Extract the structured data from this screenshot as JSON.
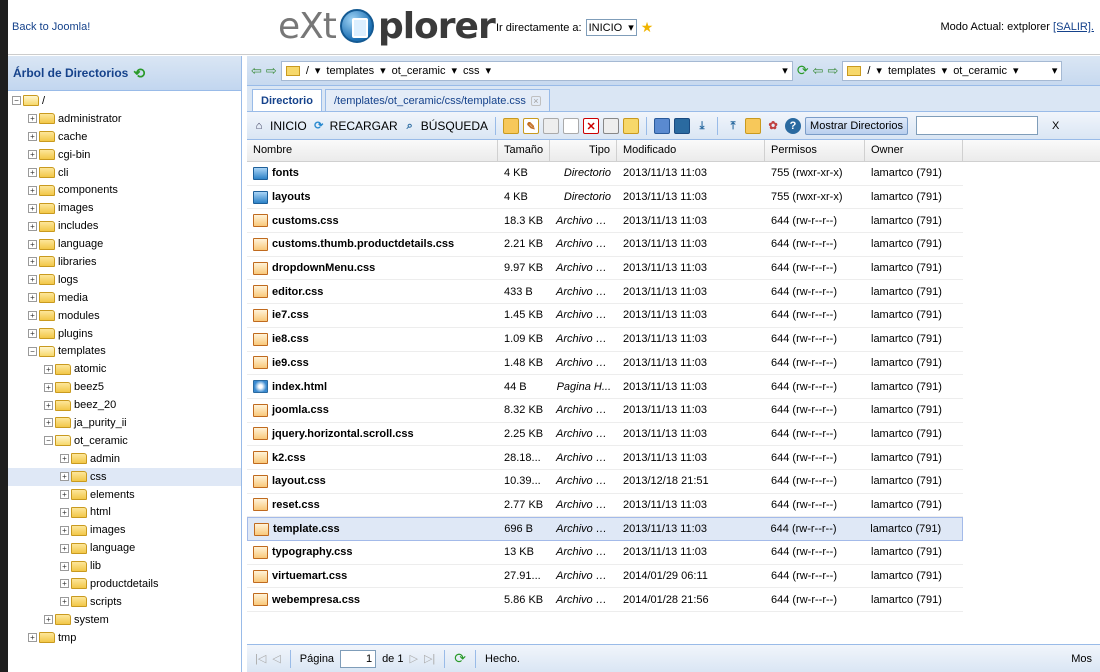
{
  "header": {
    "back_link": "Back to Joomla!",
    "logo_left": "eXt",
    "logo_right": "plorer",
    "goto_label": "Ir directamente a:",
    "goto_value": "INICIO",
    "mode_text": "Modo Actual: extplorer",
    "logout": "[SALIR]."
  },
  "tree": {
    "title": "Árbol de Directorios",
    "nodes": [
      {
        "label": "/",
        "level": 0,
        "open": true
      },
      {
        "label": "administrator",
        "level": 1
      },
      {
        "label": "cache",
        "level": 1
      },
      {
        "label": "cgi-bin",
        "level": 1
      },
      {
        "label": "cli",
        "level": 1
      },
      {
        "label": "components",
        "level": 1
      },
      {
        "label": "images",
        "level": 1
      },
      {
        "label": "includes",
        "level": 1
      },
      {
        "label": "language",
        "level": 1
      },
      {
        "label": "libraries",
        "level": 1
      },
      {
        "label": "logs",
        "level": 1
      },
      {
        "label": "media",
        "level": 1
      },
      {
        "label": "modules",
        "level": 1
      },
      {
        "label": "plugins",
        "level": 1
      },
      {
        "label": "templates",
        "level": 1,
        "open": true
      },
      {
        "label": "atomic",
        "level": 2
      },
      {
        "label": "beez5",
        "level": 2
      },
      {
        "label": "beez_20",
        "level": 2
      },
      {
        "label": "ja_purity_ii",
        "level": 2
      },
      {
        "label": "ot_ceramic",
        "level": 2,
        "open": true
      },
      {
        "label": "admin",
        "level": 3
      },
      {
        "label": "css",
        "level": 3,
        "selected": true
      },
      {
        "label": "elements",
        "level": 3
      },
      {
        "label": "html",
        "level": 3
      },
      {
        "label": "images",
        "level": 3
      },
      {
        "label": "language",
        "level": 3
      },
      {
        "label": "lib",
        "level": 3
      },
      {
        "label": "productdetails",
        "level": 3
      },
      {
        "label": "scripts",
        "level": 3
      },
      {
        "label": "system",
        "level": 2
      },
      {
        "label": "tmp",
        "level": 1
      }
    ]
  },
  "nav": {
    "path_parts": [
      "/",
      "templates",
      "ot_ceramic",
      "css"
    ],
    "path_parts_right": [
      "/",
      "templates",
      "ot_ceramic"
    ]
  },
  "tabs": [
    "Directorio",
    "/templates/ot_ceramic/css/template.css"
  ],
  "toolbar": {
    "inicio": "INICIO",
    "recargar": "RECARGAR",
    "busqueda": "BÚSQUEDA",
    "mostrar": "Mostrar Directorios",
    "clear": "X"
  },
  "columns": [
    "Nombre",
    "Tamaño",
    "Tipo",
    "Modificado",
    "Permisos",
    "Owner"
  ],
  "files": [
    {
      "name": "fonts",
      "size": "4 KB",
      "type": "Directorio",
      "mod": "2013/11/13 11:03",
      "perm": "755 (rwxr-xr-x)",
      "owner": "lamartco (791)",
      "kind": "dir"
    },
    {
      "name": "layouts",
      "size": "4 KB",
      "type": "Directorio",
      "mod": "2013/11/13 11:03",
      "perm": "755 (rwxr-xr-x)",
      "owner": "lamartco (791)",
      "kind": "dir"
    },
    {
      "name": "customs.css",
      "size": "18.3 KB",
      "type": "Archivo C...",
      "mod": "2013/11/13 11:03",
      "perm": "644 (rw-r--r--)",
      "owner": "lamartco (791)",
      "kind": "css"
    },
    {
      "name": "customs.thumb.productdetails.css",
      "size": "2.21 KB",
      "type": "Archivo C...",
      "mod": "2013/11/13 11:03",
      "perm": "644 (rw-r--r--)",
      "owner": "lamartco (791)",
      "kind": "css"
    },
    {
      "name": "dropdownMenu.css",
      "size": "9.97 KB",
      "type": "Archivo C...",
      "mod": "2013/11/13 11:03",
      "perm": "644 (rw-r--r--)",
      "owner": "lamartco (791)",
      "kind": "css"
    },
    {
      "name": "editor.css",
      "size": "433 B",
      "type": "Archivo C...",
      "mod": "2013/11/13 11:03",
      "perm": "644 (rw-r--r--)",
      "owner": "lamartco (791)",
      "kind": "css"
    },
    {
      "name": "ie7.css",
      "size": "1.45 KB",
      "type": "Archivo C...",
      "mod": "2013/11/13 11:03",
      "perm": "644 (rw-r--r--)",
      "owner": "lamartco (791)",
      "kind": "css"
    },
    {
      "name": "ie8.css",
      "size": "1.09 KB",
      "type": "Archivo C...",
      "mod": "2013/11/13 11:03",
      "perm": "644 (rw-r--r--)",
      "owner": "lamartco (791)",
      "kind": "css"
    },
    {
      "name": "ie9.css",
      "size": "1.48 KB",
      "type": "Archivo C...",
      "mod": "2013/11/13 11:03",
      "perm": "644 (rw-r--r--)",
      "owner": "lamartco (791)",
      "kind": "css"
    },
    {
      "name": "index.html",
      "size": "44 B",
      "type": "Pagina H...",
      "mod": "2013/11/13 11:03",
      "perm": "644 (rw-r--r--)",
      "owner": "lamartco (791)",
      "kind": "html"
    },
    {
      "name": "joomla.css",
      "size": "8.32 KB",
      "type": "Archivo C...",
      "mod": "2013/11/13 11:03",
      "perm": "644 (rw-r--r--)",
      "owner": "lamartco (791)",
      "kind": "css"
    },
    {
      "name": "jquery.horizontal.scroll.css",
      "size": "2.25 KB",
      "type": "Archivo C...",
      "mod": "2013/11/13 11:03",
      "perm": "644 (rw-r--r--)",
      "owner": "lamartco (791)",
      "kind": "css"
    },
    {
      "name": "k2.css",
      "size": "28.18...",
      "type": "Archivo C...",
      "mod": "2013/11/13 11:03",
      "perm": "644 (rw-r--r--)",
      "owner": "lamartco (791)",
      "kind": "css"
    },
    {
      "name": "layout.css",
      "size": "10.39...",
      "type": "Archivo C...",
      "mod": "2013/12/18 21:51",
      "perm": "644 (rw-r--r--)",
      "owner": "lamartco (791)",
      "kind": "css"
    },
    {
      "name": "reset.css",
      "size": "2.77 KB",
      "type": "Archivo C...",
      "mod": "2013/11/13 11:03",
      "perm": "644 (rw-r--r--)",
      "owner": "lamartco (791)",
      "kind": "css"
    },
    {
      "name": "template.css",
      "size": "696 B",
      "type": "Archivo C...",
      "mod": "2013/11/13 11:03",
      "perm": "644 (rw-r--r--)",
      "owner": "lamartco (791)",
      "kind": "css",
      "selected": true
    },
    {
      "name": "typography.css",
      "size": "13 KB",
      "type": "Archivo C...",
      "mod": "2013/11/13 11:03",
      "perm": "644 (rw-r--r--)",
      "owner": "lamartco (791)",
      "kind": "css"
    },
    {
      "name": "virtuemart.css",
      "size": "27.91...",
      "type": "Archivo C...",
      "mod": "2014/01/29 06:11",
      "perm": "644 (rw-r--r--)",
      "owner": "lamartco (791)",
      "kind": "css"
    },
    {
      "name": "webempresa.css",
      "size": "5.86 KB",
      "type": "Archivo C...",
      "mod": "2014/01/28 21:56",
      "perm": "644 (rw-r--r--)",
      "owner": "lamartco (791)",
      "kind": "css"
    }
  ],
  "pager": {
    "page_label": "Página",
    "page_value": "1",
    "of_label": "de 1",
    "status": "Hecho.",
    "right_text": "Mos"
  }
}
